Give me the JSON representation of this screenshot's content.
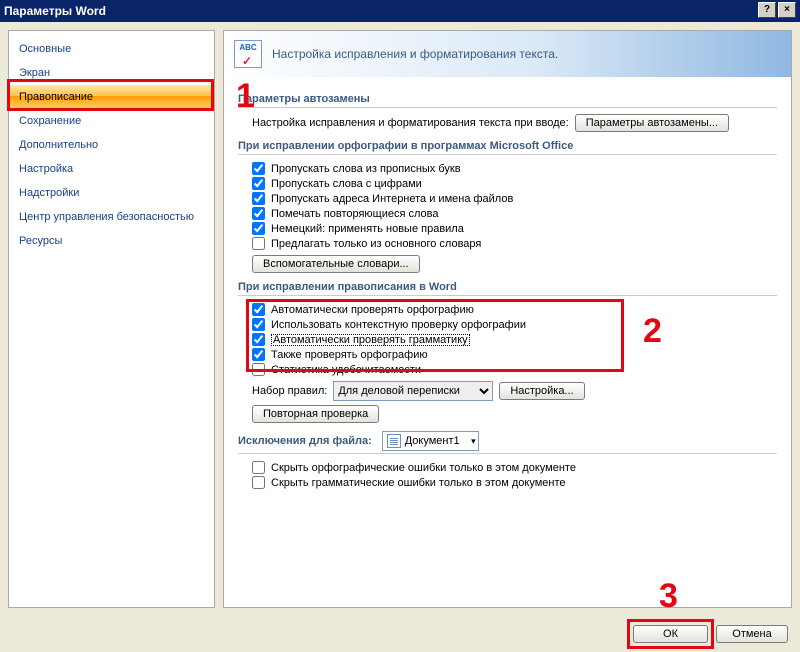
{
  "title": "Параметры Word",
  "titlebar": {
    "help": "?",
    "close": "×"
  },
  "sidebar": {
    "items": [
      "Основные",
      "Экран",
      "Правописание",
      "Сохранение",
      "Дополнительно",
      "Настройка",
      "Надстройки",
      "Центр управления безопасностью",
      "Ресурсы"
    ],
    "selected_index": 2
  },
  "banner": {
    "icon_text": "ABC",
    "heading": "Настройка исправления и форматирования текста."
  },
  "sections": {
    "autocorrect": {
      "title": "Параметры автозамены",
      "desc": "Настройка исправления и форматирования текста при вводе:",
      "button": "Параметры автозамены..."
    },
    "office_spell": {
      "title": "При исправлении орфографии в программах Microsoft Office",
      "items": [
        {
          "checked": true,
          "label": "Пропускать слова из прописных букв"
        },
        {
          "checked": true,
          "label": "Пропускать слова с цифрами"
        },
        {
          "checked": true,
          "label": "Пропускать адреса Интернета и имена файлов"
        },
        {
          "checked": true,
          "label": "Помечать повторяющиеся слова"
        },
        {
          "checked": true,
          "label": "Немецкий: применять новые правила"
        },
        {
          "checked": false,
          "label": "Предлагать только из основного словаря"
        }
      ],
      "dict_button": "Вспомогательные словари..."
    },
    "word_spell": {
      "title": "При исправлении правописания в Word",
      "items": [
        {
          "checked": true,
          "label": "Автоматически проверять орфографию"
        },
        {
          "checked": true,
          "label": "Использовать контекстную проверку орфографии"
        },
        {
          "checked": true,
          "label": "Автоматически проверять грамматику",
          "focus": true
        },
        {
          "checked": true,
          "label": "Также проверять орфографию"
        },
        {
          "checked": false,
          "label": "Статистика удобочитаемости"
        }
      ],
      "rules_label": "Набор правил:",
      "rules_value": "Для деловой переписки",
      "settings_button": "Настройка...",
      "recheck_button": "Повторная проверка"
    },
    "exceptions": {
      "title": "Исключения для файла:",
      "file_value": "Документ1",
      "items": [
        {
          "checked": false,
          "label": "Скрыть орфографические ошибки только в этом документе"
        },
        {
          "checked": false,
          "label": "Скрыть грамматические ошибки только в этом документе"
        }
      ]
    }
  },
  "footer": {
    "ok": "ОК",
    "cancel": "Отмена"
  },
  "annotations": {
    "n1": "1",
    "n2": "2",
    "n3": "3"
  }
}
